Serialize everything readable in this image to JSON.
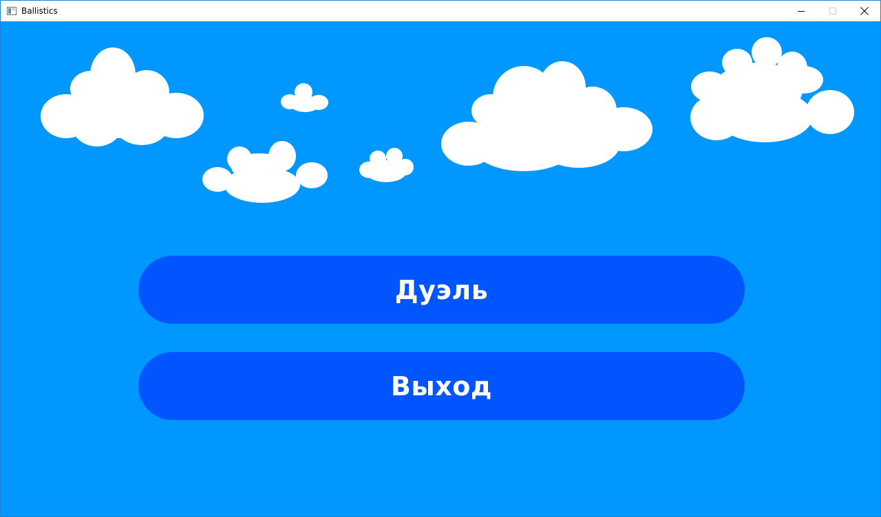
{
  "window": {
    "title": "Ballistics",
    "app_icon": "window-app-icon",
    "controls": {
      "minimize_icon": "minimize-icon",
      "maximize_icon": "maximize-icon",
      "close_icon": "close-icon"
    }
  },
  "colors": {
    "sky": "#0098ff",
    "button": "#0055ff",
    "button_text": "#ffffff",
    "cloud": "#ffffff"
  },
  "menu": {
    "duel_label": "Дуэль",
    "exit_label": "Выход"
  }
}
